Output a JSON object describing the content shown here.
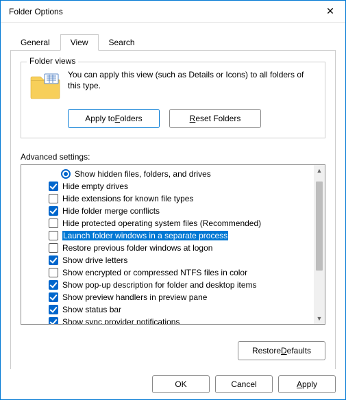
{
  "window": {
    "title": "Folder Options",
    "close_glyph": "✕"
  },
  "tabs": {
    "general": "General",
    "view": "View",
    "search": "Search"
  },
  "folder_views": {
    "legend": "Folder views",
    "desc": "You can apply this view (such as Details or Icons) to all folders of this type.",
    "apply_prefix": "Apply to ",
    "apply_u": "F",
    "apply_suffix": "olders",
    "reset_u": "R",
    "reset_suffix": "eset Folders"
  },
  "advanced": {
    "label": "Advanced settings:",
    "restore_prefix": "Restore ",
    "restore_u": "D",
    "restore_suffix": "efaults",
    "items": [
      {
        "kind": "radio",
        "checked": true,
        "label": "Show hidden files, folders, and drives",
        "selected": false
      },
      {
        "kind": "checkbox",
        "checked": true,
        "label": "Hide empty drives",
        "selected": false
      },
      {
        "kind": "checkbox",
        "checked": false,
        "label": "Hide extensions for known file types",
        "selected": false
      },
      {
        "kind": "checkbox",
        "checked": true,
        "label": "Hide folder merge conflicts",
        "selected": false
      },
      {
        "kind": "checkbox",
        "checked": false,
        "label": "Hide protected operating system files (Recommended)",
        "selected": false
      },
      {
        "kind": "checkbox",
        "checked": false,
        "label": "Launch folder windows in a separate process",
        "selected": true
      },
      {
        "kind": "checkbox",
        "checked": false,
        "label": "Restore previous folder windows at logon",
        "selected": false
      },
      {
        "kind": "checkbox",
        "checked": true,
        "label": "Show drive letters",
        "selected": false
      },
      {
        "kind": "checkbox",
        "checked": false,
        "label": "Show encrypted or compressed NTFS files in color",
        "selected": false
      },
      {
        "kind": "checkbox",
        "checked": true,
        "label": "Show pop-up description for folder and desktop items",
        "selected": false
      },
      {
        "kind": "checkbox",
        "checked": true,
        "label": "Show preview handlers in preview pane",
        "selected": false
      },
      {
        "kind": "checkbox",
        "checked": true,
        "label": "Show status bar",
        "selected": false
      },
      {
        "kind": "checkbox",
        "checked": true,
        "label": "Show sync provider notifications",
        "selected": false
      }
    ]
  },
  "buttons": {
    "ok": "OK",
    "cancel": "Cancel",
    "apply_u": "A",
    "apply_suffix": "pply"
  }
}
